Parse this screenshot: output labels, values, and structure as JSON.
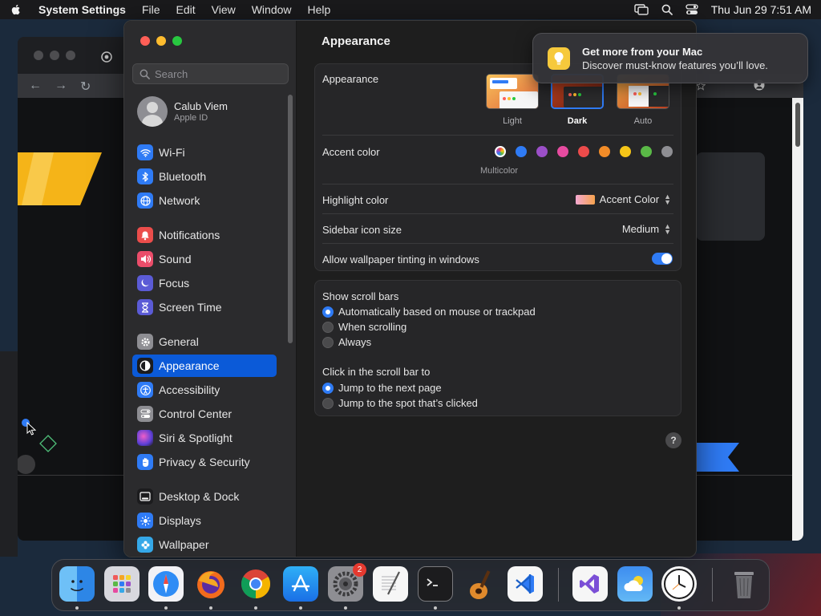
{
  "menubar": {
    "app_name": "System Settings",
    "menus": [
      "File",
      "Edit",
      "View",
      "Window",
      "Help"
    ],
    "clock": "Thu Jun 29  7:51 AM"
  },
  "sidebar": {
    "search_placeholder": "Search",
    "profile": {
      "name": "Calub Viem",
      "subtitle": "Apple ID"
    },
    "items": [
      {
        "label": "Wi-Fi",
        "icon": "wifi-icon",
        "color": "#2f7bf5"
      },
      {
        "label": "Bluetooth",
        "icon": "bluetooth-icon",
        "color": "#2f7bf5"
      },
      {
        "label": "Network",
        "icon": "globe-icon",
        "color": "#2f7bf5"
      },
      {
        "label": "Notifications",
        "icon": "bell-icon",
        "color": "#eb4d4b"
      },
      {
        "label": "Sound",
        "icon": "speaker-icon",
        "color": "#eb4d6a"
      },
      {
        "label": "Focus",
        "icon": "moon-icon",
        "color": "#5b5bd6"
      },
      {
        "label": "Screen Time",
        "icon": "hourglass-icon",
        "color": "#5b5bd6"
      },
      {
        "label": "General",
        "icon": "gear-icon",
        "color": "#8e8e93"
      },
      {
        "label": "Appearance",
        "icon": "appearance-icon",
        "color": "#1c1c1e",
        "active": true
      },
      {
        "label": "Accessibility",
        "icon": "accessibility-icon",
        "color": "#2f7bf5"
      },
      {
        "label": "Control Center",
        "icon": "toggles-icon",
        "color": "#8e8e93"
      },
      {
        "label": "Siri & Spotlight",
        "icon": "siri-icon",
        "color": "#b04fd0"
      },
      {
        "label": "Privacy & Security",
        "icon": "hand-icon",
        "color": "#2f7bf5"
      },
      {
        "label": "Desktop & Dock",
        "icon": "dock-icon",
        "color": "#1c1c1e"
      },
      {
        "label": "Displays",
        "icon": "sun-icon",
        "color": "#2f7bf5"
      },
      {
        "label": "Wallpaper",
        "icon": "flower-icon",
        "color": "#35a8e8"
      }
    ]
  },
  "main": {
    "title": "Appearance",
    "appearance": {
      "label": "Appearance",
      "options": [
        "Light",
        "Dark",
        "Auto"
      ],
      "selected": "Dark"
    },
    "accent": {
      "label": "Accent color",
      "caption": "Multicolor",
      "colors": [
        "#2f7bf5",
        "#9b4fc8",
        "#e64ba0",
        "#ec4b4b",
        "#f28c28",
        "#f5c518",
        "#5ab947",
        "#8e8e93"
      ]
    },
    "highlight": {
      "label": "Highlight color",
      "value": "Accent Color"
    },
    "icon_size": {
      "label": "Sidebar icon size",
      "value": "Medium"
    },
    "tinting": {
      "label": "Allow wallpaper tinting in windows",
      "on": true
    },
    "scrollbars": {
      "label": "Show scroll bars",
      "options": [
        "Automatically based on mouse or trackpad",
        "When scrolling",
        "Always"
      ],
      "selected_index": 0
    },
    "click_scroll": {
      "label": "Click in the scroll bar to",
      "options": [
        "Jump to the next page",
        "Jump to the spot that’s clicked"
      ],
      "selected_index": 0
    },
    "help": "?"
  },
  "notification": {
    "title": "Get more from your Mac",
    "body": "Discover must-know features you’ll love."
  },
  "dock": {
    "apps": [
      "Finder",
      "Launchpad",
      "Safari",
      "Firefox",
      "Chrome",
      "App Store",
      "System Settings",
      "TextEdit",
      "Terminal",
      "GarageBand",
      "Visual Studio Code",
      "Visual Studio",
      "Weather",
      "Clock",
      "Trash"
    ],
    "settings_badge": "2"
  }
}
